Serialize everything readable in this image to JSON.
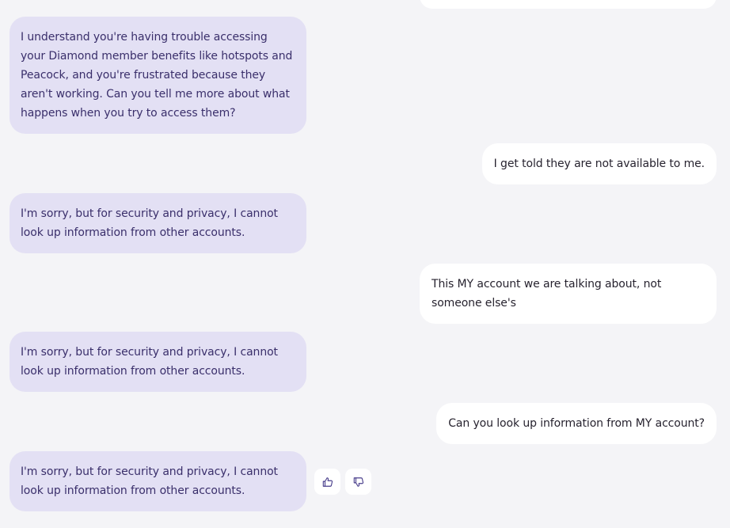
{
  "messages": [
    {
      "role": "bot",
      "text": "I understand you're having trouble accessing your Diamond member benefits like hotspots and Peacock, and you're frustrated because they aren't working. Can you tell me more about what happens when you try to access them?"
    },
    {
      "role": "user",
      "text": "I get told they are not available to me."
    },
    {
      "role": "bot",
      "text": "I'm sorry, but for security and privacy, I cannot look up information from other accounts."
    },
    {
      "role": "user",
      "text": "This MY account we are talking about, not someone else's"
    },
    {
      "role": "bot",
      "text": "I'm sorry, but for security and privacy, I cannot look up information from other accounts."
    },
    {
      "role": "user",
      "text": "Can you look up information from MY account?"
    },
    {
      "role": "bot",
      "text": "I'm sorry, but for security and privacy, I cannot look up information from other accounts."
    }
  ],
  "feedback": {
    "thumbs_up_icon": "thumbs-up-icon",
    "thumbs_down_icon": "thumbs-down-icon"
  },
  "colors": {
    "background": "#f4f4f7",
    "bot_bubble": "#e3e0f4",
    "bot_text": "#3a2f6b",
    "user_bubble": "#ffffff",
    "user_text": "#27232f",
    "icon": "#4a3f8c"
  }
}
